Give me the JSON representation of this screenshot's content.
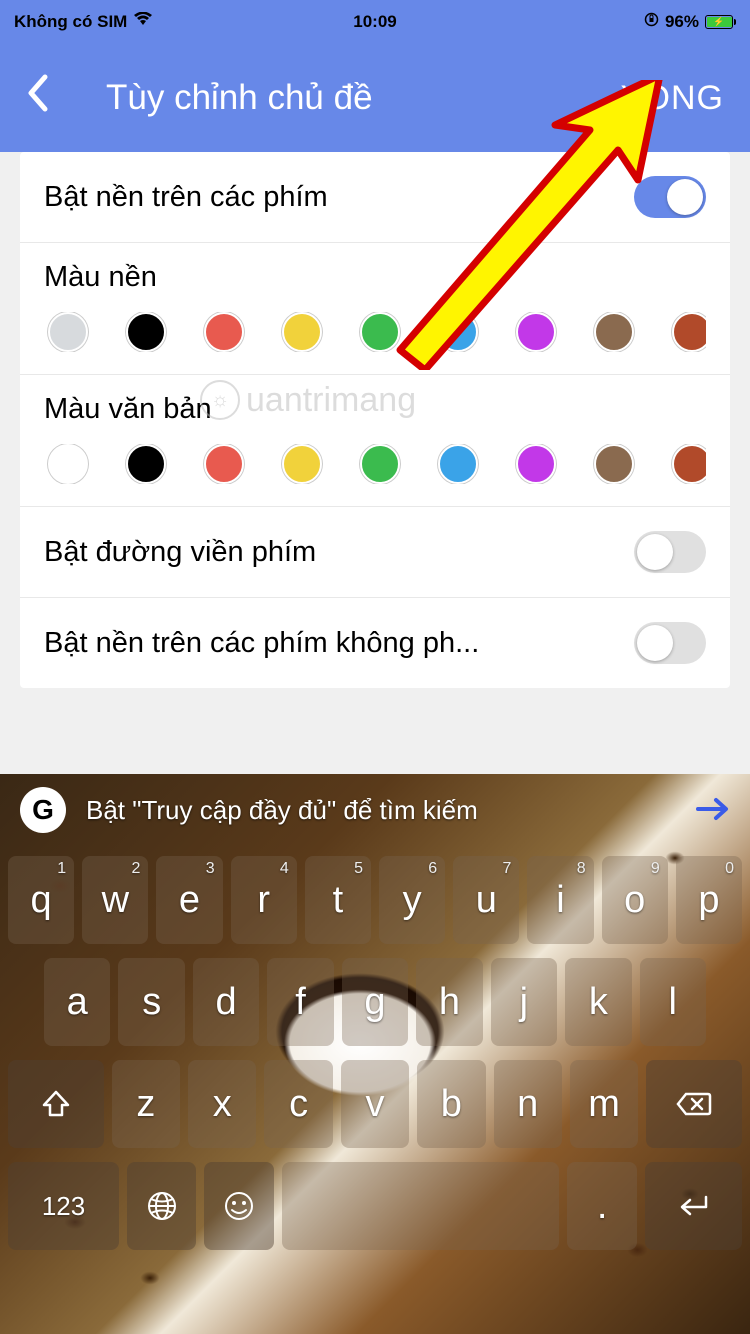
{
  "status": {
    "carrier": "Không có SIM",
    "time": "10:09",
    "battery_pct": "96%"
  },
  "nav": {
    "title": "Tùy chỉnh chủ đề",
    "done": "XONG"
  },
  "settings": {
    "key_bg_label": "Bật nền trên các phím",
    "bg_color_label": "Màu nền",
    "text_color_label": "Màu văn bản",
    "key_border_label": "Bật đường viền phím",
    "nonkey_bg_label": "Bật nền trên các phím không ph...",
    "bg_colors": [
      "#d7dadd",
      "#000000",
      "#e85a4f",
      "#f1d23b",
      "#3bbb4e",
      "#3aa3e8",
      "#c238e8",
      "#8a6a4f",
      "#b14a2a",
      "#e08a2a"
    ],
    "text_colors": [
      "#ffffff",
      "#000000",
      "#e85a4f",
      "#f1d23b",
      "#3bbb4e",
      "#3aa3e8",
      "#c238e8",
      "#8a6a4f",
      "#b14a2a",
      "#e08a2a"
    ]
  },
  "watermark": "uantrimang",
  "keyboard": {
    "suggestion": "Bật \"Truy cập đầy đủ\" để tìm kiếm",
    "g_label": "G",
    "row1": [
      {
        "k": "q",
        "n": "1"
      },
      {
        "k": "w",
        "n": "2"
      },
      {
        "k": "e",
        "n": "3"
      },
      {
        "k": "r",
        "n": "4"
      },
      {
        "k": "t",
        "n": "5"
      },
      {
        "k": "y",
        "n": "6"
      },
      {
        "k": "u",
        "n": "7"
      },
      {
        "k": "i",
        "n": "8"
      },
      {
        "k": "o",
        "n": "9"
      },
      {
        "k": "p",
        "n": "0"
      }
    ],
    "row2": [
      "a",
      "s",
      "d",
      "f",
      "g",
      "h",
      "j",
      "k",
      "l"
    ],
    "row3": [
      "z",
      "x",
      "c",
      "v",
      "b",
      "n",
      "m"
    ],
    "k123": "123",
    "dot": "."
  }
}
